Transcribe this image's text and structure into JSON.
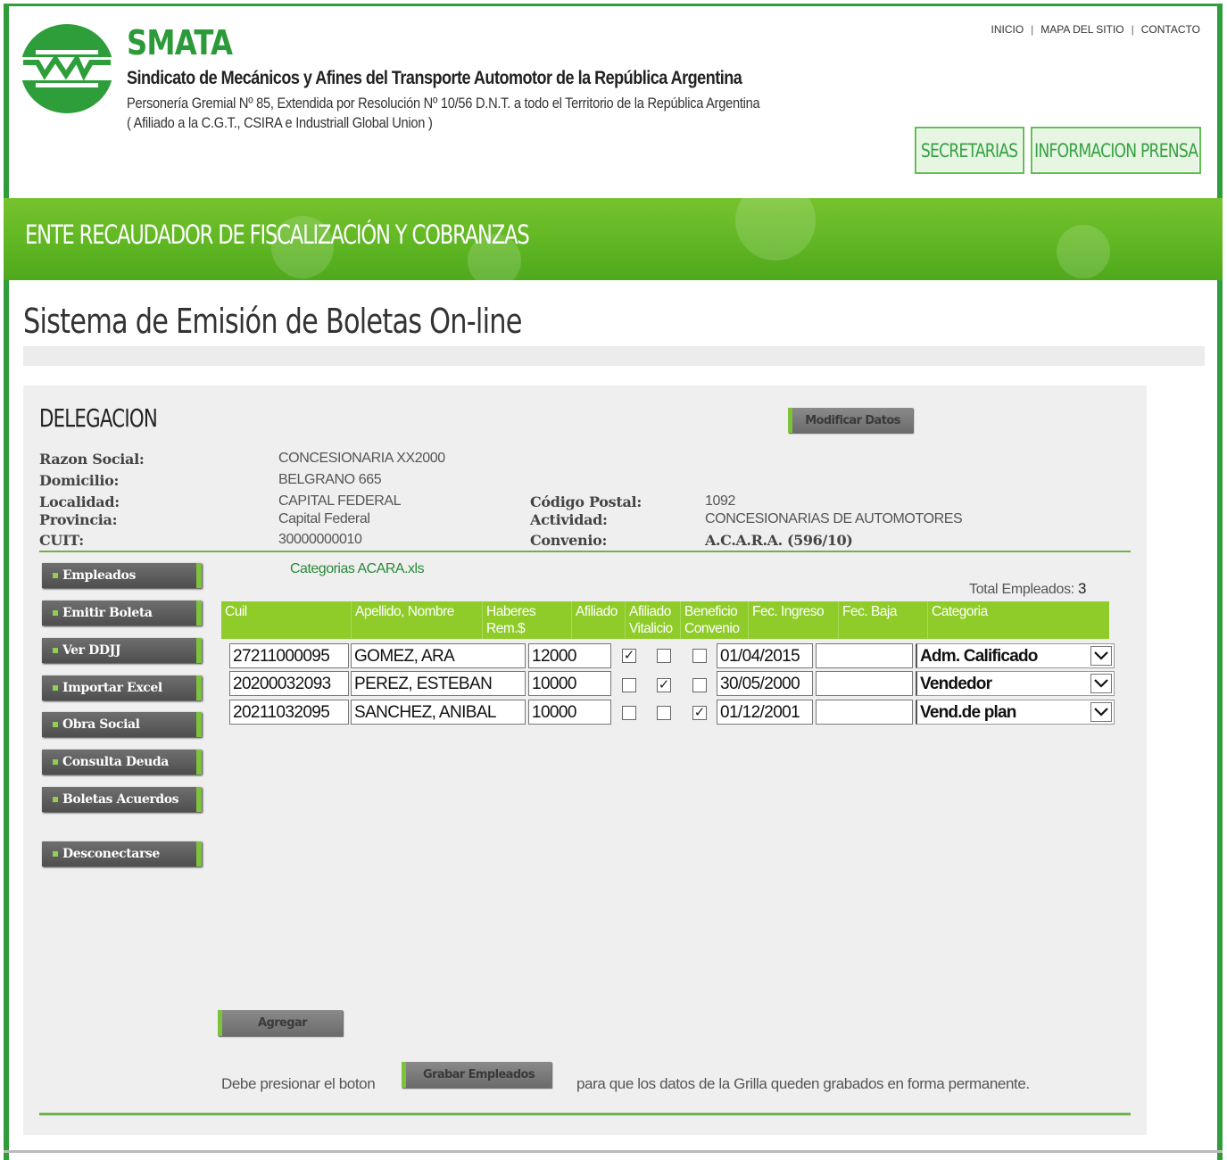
{
  "header": {
    "brand": "SMATA",
    "org_name": "Sindicato de Mecánicos y Afines del Transporte Automotor de la República Argentina",
    "personeria": "Personería Gremial Nº 85, Extendida por Resolución Nº 10/56 D.N.T. a todo el Territorio de la República Argentina",
    "afiliacion": "( Afiliado a la C.G.T., CSIRA e Industriall Global Union )",
    "top_links": [
      "INICIO",
      "MAPA DEL SITIO",
      "CONTACTO"
    ],
    "buttons": [
      "SECRETARIAS",
      "INFORMACION PRENSA"
    ]
  },
  "banner": {
    "title": "ENTE RECAUDADOR DE FISCALIZACIÓN Y COBRANZAS"
  },
  "page": {
    "title": "Sistema de Emisión de Boletas On-line"
  },
  "delegacion": {
    "heading": "DELEGACION",
    "modify_button": "Modificar Datos",
    "fields": {
      "razon_social": {
        "label": "Razon Social:",
        "value": "CONCESIONARIA XX2000"
      },
      "domicilio": {
        "label": "Domicilio:",
        "value": "BELGRANO 665"
      },
      "localidad": {
        "label": "Localidad:",
        "value": "CAPITAL FEDERAL"
      },
      "provincia": {
        "label": "Provincia:",
        "value": "Capital Federal"
      },
      "cuit": {
        "label": "CUIT:",
        "value": "30000000010"
      },
      "codigo_postal": {
        "label": "Código Postal:",
        "value": "1092"
      },
      "actividad": {
        "label": "Actividad:",
        "value": "CONCESIONARIAS DE AUTOMOTORES"
      },
      "convenio": {
        "label": "Convenio:",
        "value": "A.C.A.R.A. (596/10)"
      }
    }
  },
  "sidebar": {
    "items": [
      "Empleados",
      "Emitir Boleta",
      "Ver DDJJ",
      "Importar Excel",
      "Obra Social",
      "Consulta Deuda",
      "Boletas Acuerdos",
      "Desconectarse"
    ]
  },
  "grid": {
    "categories_link": "Categorias ACARA.xls",
    "total_label": "Total Empleados:",
    "total_value": "3",
    "columns": [
      "Cuil",
      "Apellido, Nombre",
      "Haberes Rem.$",
      "Afiliado",
      "Afiliado Vitalicio",
      "Beneficio Convenio",
      "Fec. Ingreso",
      "Fec. Baja",
      "Categoria"
    ],
    "rows": [
      {
        "cuil": "27211000095",
        "nombre": "GOMEZ, ARA",
        "haberes": "12000",
        "afiliado": true,
        "vitalicio": false,
        "beneficio": false,
        "ingreso": "01/04/2015",
        "baja": "",
        "categoria": "Adm. Calificado"
      },
      {
        "cuil": "20200032093",
        "nombre": "PEREZ, ESTEBAN",
        "haberes": "10000",
        "afiliado": false,
        "vitalicio": true,
        "beneficio": false,
        "ingreso": "30/05/2000",
        "baja": "",
        "categoria": "Vendedor"
      },
      {
        "cuil": "20211032095",
        "nombre": "SANCHEZ, ANIBAL",
        "haberes": "10000",
        "afiliado": false,
        "vitalicio": false,
        "beneficio": true,
        "ingreso": "01/12/2001",
        "baja": "",
        "categoria": "Vend.de plan"
      }
    ],
    "add_button": "Agregar",
    "note_before": "Debe presionar el boton",
    "save_button": "Grabar Empleados",
    "note_after": "para que los datos de la Grilla queden grabados en forma permanente."
  },
  "colors": {
    "brand_green": "#2b9a39",
    "banner_green": "#62b824",
    "grid_header": "#8fcc2a"
  }
}
